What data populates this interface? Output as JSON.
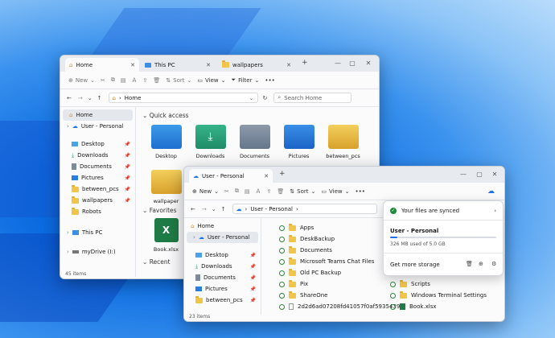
{
  "win1": {
    "tabs": [
      {
        "label": "Home"
      },
      {
        "label": "This PC"
      },
      {
        "label": "wallpapers"
      }
    ],
    "toolbar": {
      "new": "New",
      "sort": "Sort",
      "view": "View",
      "filter": "Filter",
      "more": "•••"
    },
    "address": {
      "path": "Home",
      "search_placeholder": "Search Home"
    },
    "sidebar": [
      {
        "label": "Home"
      },
      {
        "label": "User - Personal"
      },
      {
        "label": "Desktop"
      },
      {
        "label": "Downloads"
      },
      {
        "label": "Documents"
      },
      {
        "label": "Pictures"
      },
      {
        "label": "between_pcs"
      },
      {
        "label": "wallpapers"
      },
      {
        "label": "Robots"
      },
      {
        "label": "This PC"
      },
      {
        "label": "myDrive (I:)"
      }
    ],
    "quick_access": "Quick access",
    "tiles": [
      {
        "label": "Desktop"
      },
      {
        "label": "Downloads"
      },
      {
        "label": "Documents"
      },
      {
        "label": "Pictures"
      },
      {
        "label": "between_pcs"
      },
      {
        "label": "wallpaper"
      }
    ],
    "favorites": "Favorites",
    "fav_file": "Book.xlsx",
    "recent": "Recent",
    "status": "45 items"
  },
  "win2": {
    "tabs": [
      {
        "label": "User - Personal"
      }
    ],
    "toolbar": {
      "new": "New",
      "sort": "Sort",
      "view": "View",
      "more": "•••"
    },
    "address": {
      "path": "User - Personal"
    },
    "sidebar": [
      {
        "label": "Home"
      },
      {
        "label": "User - Personal"
      },
      {
        "label": "Desktop"
      },
      {
        "label": "Downloads"
      },
      {
        "label": "Documents"
      },
      {
        "label": "Pictures"
      },
      {
        "label": "between_pcs"
      }
    ],
    "files": [
      {
        "name": "Apps"
      },
      {
        "name": "DeskBackup"
      },
      {
        "name": "Documents"
      },
      {
        "name": "Microsoft Teams Chat Files"
      },
      {
        "name": "Old PC Backup"
      },
      {
        "name": "Pix"
      },
      {
        "name": "ShareOne"
      },
      {
        "name": "2d2d6ad07208fd41057f0af5935439..."
      }
    ],
    "files_right": [
      {
        "name": "Scripts"
      },
      {
        "name": "Windows Terminal Settings"
      },
      {
        "name": "Book.xlsx"
      }
    ],
    "status": "23 items"
  },
  "flyout": {
    "synced": "Your files are synced",
    "account": "User - Personal",
    "usage": "326 MB used of 5.0 GB",
    "usage_fraction": 0.065,
    "get_storage": "Get more storage"
  }
}
